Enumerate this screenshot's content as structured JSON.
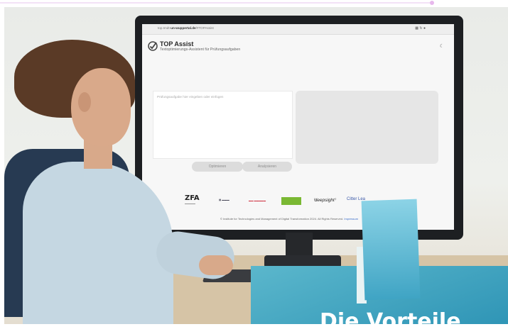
{
  "browser": {
    "url_prefix": "top.tmdt-",
    "url_domain": "un-wuppertal.de",
    "url_suffix": "/#TOPAssist"
  },
  "app": {
    "title": "TOP Assist",
    "subtitle": "Textoptimierungs-Assistent für Prüfungsaufgaben",
    "input_placeholder": "Prüfungsaufgabe hier eingeben oder einfügen",
    "optimize_label": "Optimieren",
    "analyze_label": "Analysieren"
  },
  "partners": {
    "zfa": "ZFA",
    "deepsight": "deepsight",
    "sixth": "Citter Lea"
  },
  "footer": {
    "text": "© Institute for Technologies and Management of Digital Transformation 2024. All Rights Reserved.",
    "link": "Impressum"
  },
  "overlay": {
    "heading": "Die Vorteile"
  },
  "colors": {
    "accent_green": "#7ab833",
    "paper_blue": "#3fa4c4"
  }
}
